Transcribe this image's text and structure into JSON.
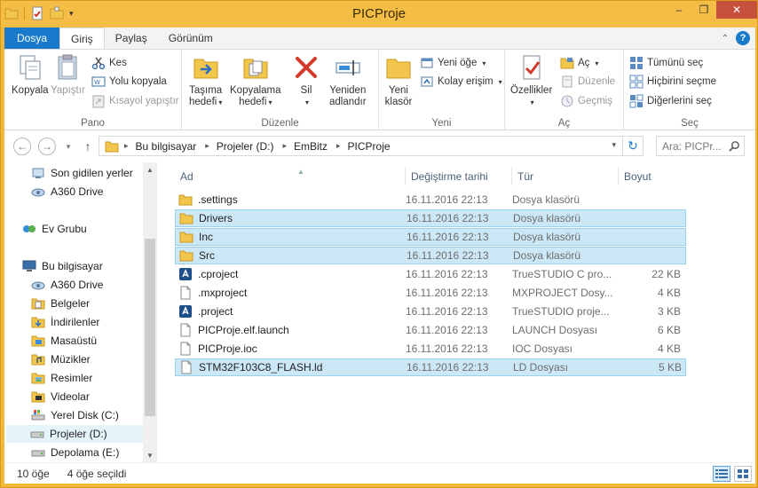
{
  "window": {
    "title": "PICProje",
    "controls": [
      "–",
      "❐",
      "✕"
    ]
  },
  "tabs": {
    "file": "Dosya",
    "items": [
      "Giriş",
      "Paylaş",
      "Görünüm"
    ]
  },
  "ribbon": {
    "pano": {
      "label": "Pano",
      "copy": "Kopyala",
      "paste": "Yapıştır",
      "cut": "Kes",
      "copy_path": "Yolu kopyala",
      "paste_shortcut": "Kısayol yapıştır"
    },
    "duzenle": {
      "label": "Düzenle",
      "move_to_1": "Taşıma",
      "move_to_2": "hedefi",
      "copy_to_1": "Kopyalama",
      "copy_to_2": "hedefi",
      "delete": "Sil",
      "rename_1": "Yeniden",
      "rename_2": "adlandır"
    },
    "yeni": {
      "label": "Yeni",
      "new_folder_1": "Yeni",
      "new_folder_2": "klasör",
      "new_item": "Yeni öğe",
      "easy_access": "Kolay erişim"
    },
    "ac": {
      "label": "Aç",
      "properties": "Özellikler",
      "open": "Aç",
      "edit": "Düzenle",
      "history": "Geçmiş"
    },
    "sec": {
      "label": "Seç",
      "select_all": "Tümünü seç",
      "select_none": "Hiçbirini seçme",
      "invert": "Diğerlerini seç"
    }
  },
  "address": {
    "crumbs": [
      "Bu bilgisayar",
      "Projeler (D:)",
      "EmBitz",
      "PICProje"
    ],
    "search_placeholder": "Ara: PICPr..."
  },
  "navpane": {
    "items": [
      {
        "label": "Son gidilen yerler",
        "icon": "recent-places-icon"
      },
      {
        "label": "A360 Drive",
        "icon": "cloud-drive-icon"
      },
      {
        "label": "Ev Grubu",
        "icon": "homegroup-icon"
      },
      {
        "label": "Bu bilgisayar",
        "icon": "computer-icon"
      },
      {
        "label": "A360 Drive",
        "icon": "cloud-drive-icon"
      },
      {
        "label": "Belgeler",
        "icon": "documents-folder-icon"
      },
      {
        "label": "İndirilenler",
        "icon": "downloads-folder-icon"
      },
      {
        "label": "Masaüstü",
        "icon": "desktop-folder-icon"
      },
      {
        "label": "Müzikler",
        "icon": "music-folder-icon"
      },
      {
        "label": "Resimler",
        "icon": "pictures-folder-icon"
      },
      {
        "label": "Videolar",
        "icon": "videos-folder-icon"
      },
      {
        "label": "Yerel Disk (C:)",
        "icon": "system-drive-icon"
      },
      {
        "label": "Projeler (D:)",
        "icon": "drive-icon"
      },
      {
        "label": "Depolama (E:)",
        "icon": "drive-icon"
      }
    ]
  },
  "columns": {
    "name": "Ad",
    "date": "Değiştirme tarihi",
    "type": "Tür",
    "size": "Boyut"
  },
  "files": [
    {
      "name": ".settings",
      "date": "16.11.2016 22:13",
      "type": "Dosya klasörü",
      "size": "",
      "kind": "folder",
      "selected": false
    },
    {
      "name": "Drivers",
      "date": "16.11.2016 22:13",
      "type": "Dosya klasörü",
      "size": "",
      "kind": "folder",
      "selected": true
    },
    {
      "name": "Inc",
      "date": "16.11.2016 22:13",
      "type": "Dosya klasörü",
      "size": "",
      "kind": "folder",
      "selected": true
    },
    {
      "name": "Src",
      "date": "16.11.2016 22:13",
      "type": "Dosya klasörü",
      "size": "",
      "kind": "folder",
      "selected": true
    },
    {
      "name": ".cproject",
      "date": "16.11.2016 22:13",
      "type": "TrueSTUDIO C pro...",
      "size": "22 KB",
      "kind": "truestudio",
      "selected": false
    },
    {
      "name": ".mxproject",
      "date": "16.11.2016 22:13",
      "type": "MXPROJECT Dosy...",
      "size": "4 KB",
      "kind": "file",
      "selected": false
    },
    {
      "name": ".project",
      "date": "16.11.2016 22:13",
      "type": "TrueSTUDIO proje...",
      "size": "3 KB",
      "kind": "truestudio",
      "selected": false
    },
    {
      "name": "PICProje.elf.launch",
      "date": "16.11.2016 22:13",
      "type": "LAUNCH Dosyası",
      "size": "6 KB",
      "kind": "file",
      "selected": false
    },
    {
      "name": "PICProje.ioc",
      "date": "16.11.2016 22:13",
      "type": "IOC Dosyası",
      "size": "4 KB",
      "kind": "file",
      "selected": false
    },
    {
      "name": "STM32F103C8_FLASH.ld",
      "date": "16.11.2016 22:13",
      "type": "LD Dosyası",
      "size": "5 KB",
      "kind": "file",
      "selected": true
    }
  ],
  "status": {
    "count": "10 öğe",
    "selected": "4 öğe seçildi"
  },
  "colors": {
    "accent": "#1979ca",
    "frame": "#f3b83a",
    "selection": "#cce8f7",
    "folder": "#f2c64d"
  }
}
